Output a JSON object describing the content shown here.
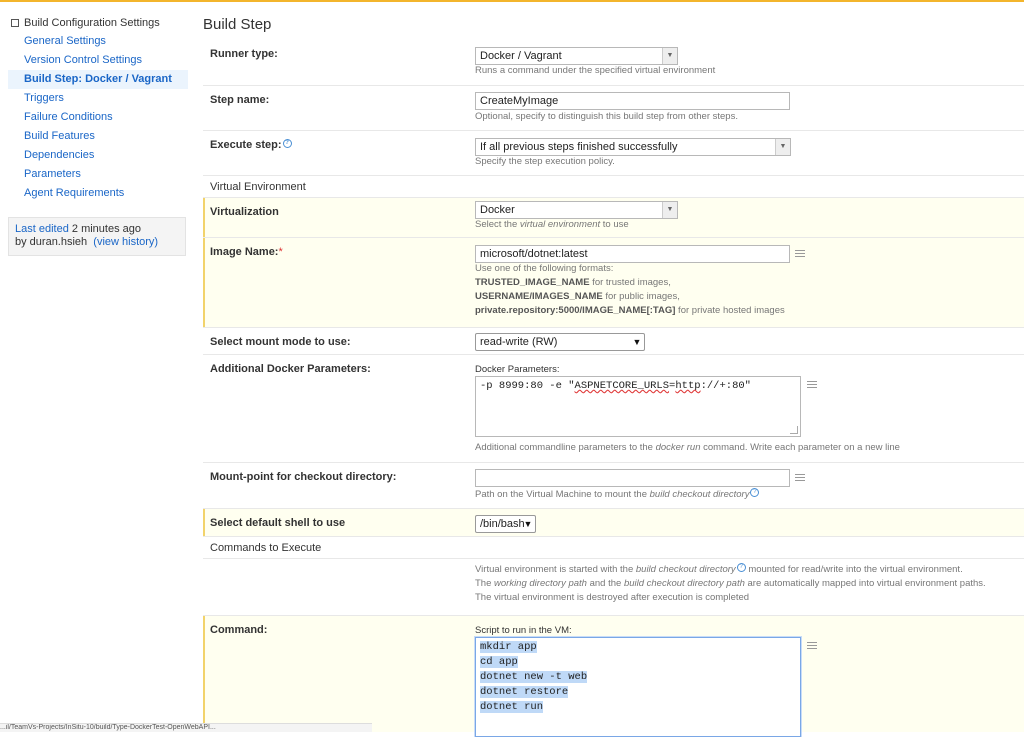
{
  "sidebar": {
    "title": "Build Configuration Settings",
    "items": [
      {
        "label": "General Settings",
        "active": false
      },
      {
        "label": "Version Control Settings",
        "active": false
      },
      {
        "label": "Build Step: Docker / Vagrant",
        "active": true
      },
      {
        "label": "Triggers",
        "active": false
      },
      {
        "label": "Failure Conditions",
        "active": false
      },
      {
        "label": "Build Features",
        "active": false
      },
      {
        "label": "Dependencies",
        "active": false
      },
      {
        "label": "Parameters",
        "active": false
      },
      {
        "label": "Agent Requirements",
        "active": false
      }
    ],
    "last_edited": {
      "prefix": "Last edited",
      "time": "2 minutes ago",
      "by": "by duran.hsieh",
      "history": "(view history)"
    }
  },
  "main": {
    "title": "Build Step",
    "runner_type": {
      "label": "Runner type:",
      "value": "Docker / Vagrant",
      "note": "Runs a command under the specified virtual environment"
    },
    "step_name": {
      "label": "Step name:",
      "value": "CreateMyImage",
      "note": "Optional, specify to distinguish this build step from other steps."
    },
    "execute_step": {
      "label": "Execute step:",
      "help": "?",
      "value": "If all previous steps finished successfully",
      "note": "Specify the step execution policy."
    },
    "virtual_env_section": "Virtual Environment",
    "virtualization": {
      "label": "Virtualization",
      "value": "Docker",
      "note_pre": "Select the ",
      "note_em": "virtual environment",
      "note_post": " to use"
    },
    "image_name": {
      "label": "Image Name:",
      "required": "*",
      "value": "microsoft/dotnet:latest",
      "note_intro": "Use one of the following formats:",
      "formats": [
        {
          "bold": "TRUSTED_IMAGE_NAME",
          "text": " for trusted images,"
        },
        {
          "bold": "USERNAME/IMAGES_NAME",
          "text": " for public images,"
        },
        {
          "bold": "private.repository:5000/IMAGE_NAME[:TAG]",
          "text": " for private hosted images"
        }
      ]
    },
    "mount_mode": {
      "label": "Select mount mode to use:",
      "value": "read-write (RW)"
    },
    "docker_params": {
      "label": "Additional Docker Parameters:",
      "caption": "Docker Parameters:",
      "value_pre": "-p 8999:80 -e \"",
      "value_spell1": "ASPNETCORE_URLS",
      "value_eq": "=",
      "value_spell2": "http",
      "value_post": "://+:80\"",
      "note_pre": "Additional commandline parameters to the ",
      "note_em": "docker run",
      "note_post": " command. Write each parameter on a new line"
    },
    "mount_point": {
      "label": "Mount-point for checkout directory:",
      "value": "",
      "note_pre": "Path on the Virtual Machine to mount the ",
      "note_em": "build checkout directory",
      "help": "?"
    },
    "default_shell": {
      "label": "Select default shell to use",
      "value": "/bin/bash"
    },
    "commands_section": "Commands to Execute",
    "env_info": {
      "line1_pre": "Virtual environment is started with the ",
      "line1_em": "build checkout directory",
      "line1_help": "?",
      "line1_post": " mounted for read/write into the virtual environment.",
      "line2_pre": "The ",
      "line2_em1": "working directory path",
      "line2_mid": " and the ",
      "line2_em2": "build checkout directory path",
      "line2_post": " are automatically mapped into virtual environment paths.",
      "line3": "The virtual environment is destroyed after execution is completed"
    },
    "command": {
      "label": "Command:",
      "caption": "Script to run in the VM:",
      "lines": [
        "mkdir app",
        "cd app",
        "dotnet new -t web",
        "dotnet restore",
        "dotnet run"
      ]
    }
  },
  "status_bar": "...il/TeamVs-Projects/InSitu-10/build/Type-DockerTest-OpenWebAPI..."
}
